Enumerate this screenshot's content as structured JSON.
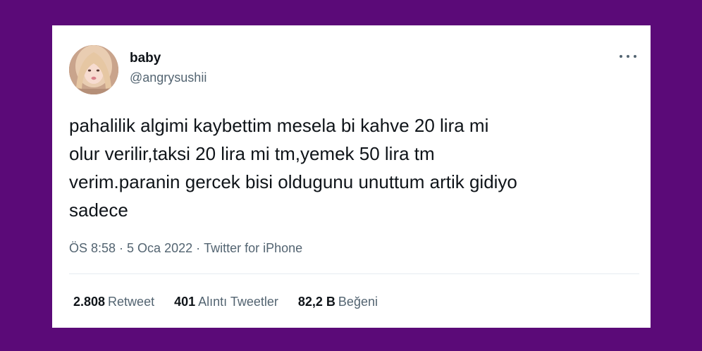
{
  "tweet": {
    "author": {
      "display_name": "baby",
      "handle": "@angrysushii",
      "avatar": "profile-photo"
    },
    "more_icon": "more-horizontal-icon",
    "text": "pahalilik algimi kaybettim mesela bi kahve 20 lira mi\nolur verilir,taksi 20 lira mi tm,yemek 50 lira tm\nverim.paranin gercek bisi oldugunu unuttum artik gidiyo\nsadece",
    "time": "ÖS 8:58",
    "separator": "·",
    "date": "5 Oca 2022",
    "source": "Twitter for iPhone",
    "stats": [
      {
        "count": "2.808",
        "label": "Retweet"
      },
      {
        "count": "401",
        "label": "Alıntı Tweetler"
      },
      {
        "count": "82,2 B",
        "label": "Beğeni"
      }
    ]
  },
  "colors": {
    "background": "#5b0a78",
    "card": "#ffffff",
    "primary_text": "#0f1419",
    "secondary_text": "#536471",
    "divider": "#e6ecf0"
  }
}
